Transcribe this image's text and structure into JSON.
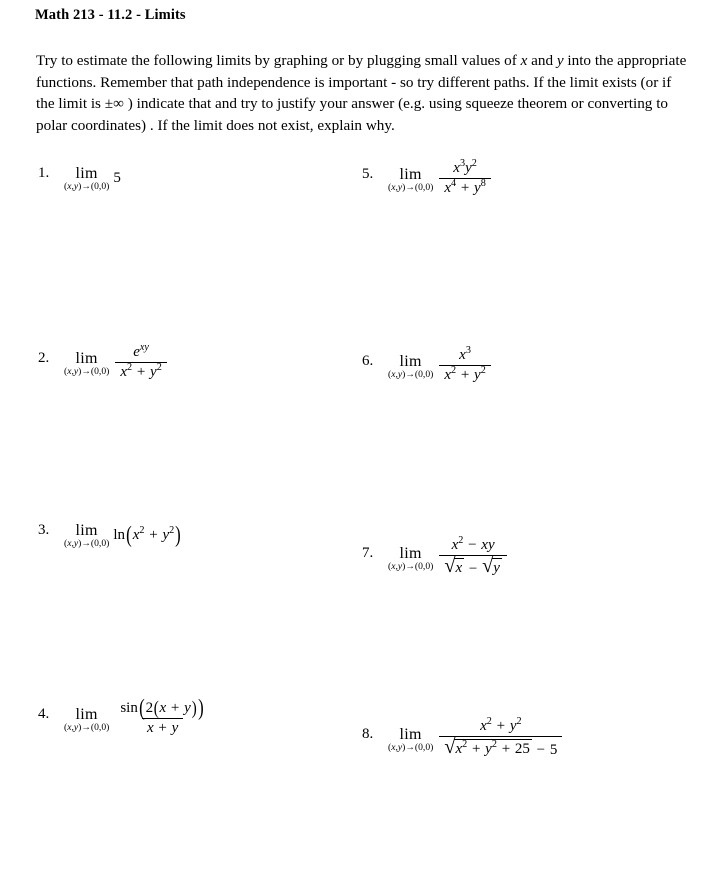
{
  "document": {
    "title": "Math 213 - 11.2 - Limits",
    "instructions": "Try to estimate the following limits by graphing or by plugging small values of x and y into the appropriate functions. Remember that path independence is important - so try different paths. If the limit exists (or if the limit is ±∞ ) indicate that and try to justify your answer (e.g. using squeeze theorem or converting to polar coordinates) . If the limit does not exist, explain why.",
    "limit_operator": {
      "label": "lim",
      "subscript": "(x,y)→(0,0)"
    },
    "problems": [
      {
        "number": "1.",
        "column": "left",
        "expression": "lim (x,y)->(0,0) 5",
        "body": "5",
        "kind": "constant"
      },
      {
        "number": "2.",
        "column": "left",
        "expression": "lim (x,y)->(0,0) e^(xy) / (x^2 + y^2)",
        "numerator": "e^(xy)",
        "denominator": "x^2 + y^2",
        "kind": "fraction"
      },
      {
        "number": "3.",
        "column": "left",
        "expression": "lim (x,y)->(0,0) ln(x^2 + y^2)",
        "body": "ln(x^2 + y^2)",
        "kind": "function"
      },
      {
        "number": "4.",
        "column": "left",
        "expression": "lim (x,y)->(0,0) sin(2(x + y)) / (x + y)",
        "numerator": "sin(2(x + y))",
        "denominator": "x + y",
        "kind": "fraction"
      },
      {
        "number": "5.",
        "column": "right",
        "expression": "lim (x,y)->(0,0) x^3 y^2 / (x^4 + y^8)",
        "numerator": "x^3 y^2",
        "denominator": "x^4 + y^8",
        "kind": "fraction"
      },
      {
        "number": "6.",
        "column": "right",
        "expression": "lim (x,y)->(0,0) x^3 / (x^2 + y^2)",
        "numerator": "x^3",
        "denominator": "x^2 + y^2",
        "kind": "fraction"
      },
      {
        "number": "7.",
        "column": "right",
        "expression": "lim (x,y)->(0,0) (x^2 - xy) / (sqrt(x) - sqrt(y))",
        "numerator": "x^2 - xy",
        "denominator": "sqrt(x) - sqrt(y)",
        "kind": "fraction"
      },
      {
        "number": "8.",
        "column": "right",
        "expression": "lim (x,y)->(0,0) (x^2 + y^2) / (sqrt(x^2 + y^2 + 25) - 5)",
        "numerator": "x^2 + y^2",
        "denominator": "sqrt(x^2 + y^2 + 25) - 5",
        "kind": "fraction"
      }
    ]
  }
}
